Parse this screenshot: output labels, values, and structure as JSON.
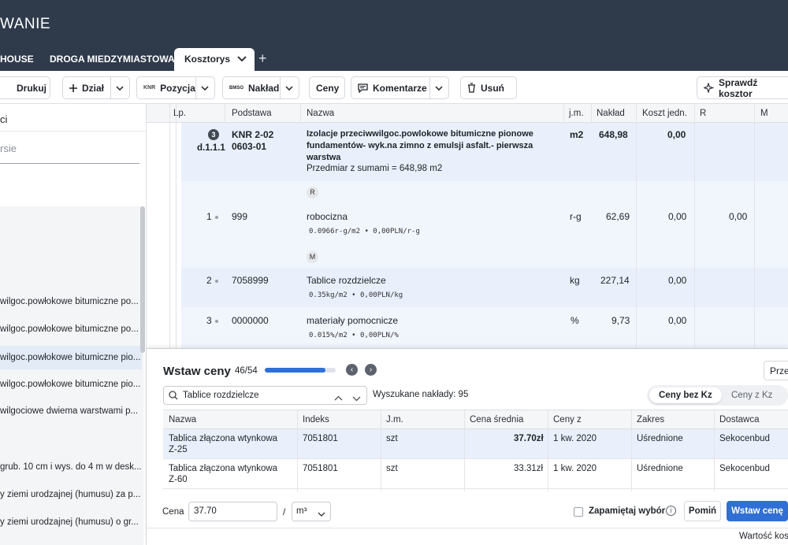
{
  "app": {
    "title": "WANIE"
  },
  "tabs": [
    {
      "label": "HOUSE"
    },
    {
      "label": "DROGA MIEDZYMIASTOWA"
    },
    {
      "label": "Kosztorys"
    }
  ],
  "toolbar": {
    "drukuj": "Drukuj",
    "dzial": "Dział",
    "pozycja_prefix": "KNR",
    "pozycja": "Pozycja",
    "naklad_icon_top": "BM",
    "naklad_icon_bottom": "SO",
    "naklad": "Nakład",
    "ceny": "Ceny",
    "komentarze": "Komentarze",
    "usun": "Usuń",
    "sprawdz": "Sprawdź kosztor"
  },
  "left_panel": {
    "title": "ci",
    "search_placeholder": "rsie",
    "items": [
      "wilgoc.powłokowe bitumiczne po...",
      "wilgoc.powłokowe bitumiczne po...",
      "wilgoc.powłokowe bitumiczne pio...",
      "wilgoc.powłokowe bitumiczne pio...",
      "wilgociowe dwiema warstwami p...",
      "grub. 10 cm i wys. do 4 m w desk...",
      "y ziemi urodzajnej (humusu) za p...",
      "y ziemi urodzajnej (humusu) o gr..."
    ]
  },
  "grid": {
    "headers": [
      "Lp.",
      "Podstawa",
      "Nazwa",
      "j.m.",
      "Nakład",
      "Koszt jedn.",
      "R",
      "M"
    ],
    "position": {
      "badge_num": "3",
      "lp": "d.1.1.1",
      "podstawa_line1": "KNR 2-02",
      "podstawa_line2": "0603-01",
      "nazwa_line1": "Izolacje przeciwwilgoc.powlokowe bitumiczne pionowe",
      "nazwa_line2": "fundamentów- wyk.na zimno z emulsji asfalt.- pierwsza",
      "nazwa_line3": "warstwa",
      "przedmiar": "Przedmiar z sumami = 648,98 m2",
      "jm": "m2",
      "naklad": "648,98",
      "koszt": "0,00"
    },
    "section_r": "R",
    "section_m": "M",
    "rows": [
      {
        "lp": "1",
        "podstawa": "999",
        "nazwa": "robocizna",
        "formula": "0.0966r-g/m2 • 0,00PLN/r-g",
        "jm": "r-g",
        "naklad": "62,69",
        "koszt": "0,00",
        "r": "0,00"
      },
      {
        "lp": "2",
        "podstawa": "7058999",
        "nazwa": "Tablice rozdzielcze",
        "formula": "0.35kg/m2 • 0,00PLN/kg",
        "jm": "kg",
        "naklad": "227,14",
        "koszt": "0,00"
      },
      {
        "lp": "3",
        "podstawa": "0000000",
        "nazwa": "materiały pomocnicze",
        "formula": "0.015%/m2 • 0,00PLN/%",
        "jm": "%",
        "naklad": "9,73",
        "koszt": "0,00"
      }
    ]
  },
  "insert_panel": {
    "title": "Wstaw ceny",
    "counter": "46/54",
    "progress": 0.85,
    "prze": "Prze",
    "search_value": "Tablice rozdzielcze",
    "found": "Wyszukane nakłady: 95",
    "toggle_on": "Ceny bez Kz",
    "toggle_off": "Ceny z Kz",
    "headers": [
      "Nazwa",
      "Indeks",
      "J.m.",
      "Cena średnia",
      "Ceny z",
      "Zakres",
      "Dostawca"
    ],
    "rows": [
      {
        "nazwa1": "Tablica złączona wtynkowa",
        "nazwa2": "Z-25",
        "indeks": "7051801",
        "jm": "szt",
        "cena": "37.70zł",
        "ceny_z": "1 kw. 2020",
        "zakres": "Uśrednione",
        "dostawca": "Sekocenbud"
      },
      {
        "nazwa1": "Tablica złączona wtynkowa",
        "nazwa2": "Z-60",
        "indeks": "7051801",
        "jm": "szt",
        "cena": "33.31zł",
        "ceny_z": "1 kw. 2020",
        "zakres": "Uśrednione",
        "dostawca": "Sekocenbud"
      }
    ],
    "cena_label": "Cena",
    "cena_value": "37.70",
    "slash": "/",
    "unit": "m³",
    "remember": "Zapamiętaj wybór",
    "pomin": "Pomiń",
    "wstaw": "Wstaw cenę",
    "wartosc": "Wartość kos"
  },
  "colors": {
    "header_bg": "#2f3a4b",
    "accent": "#2f6fd6",
    "selected_row": "#e9f0fb"
  }
}
